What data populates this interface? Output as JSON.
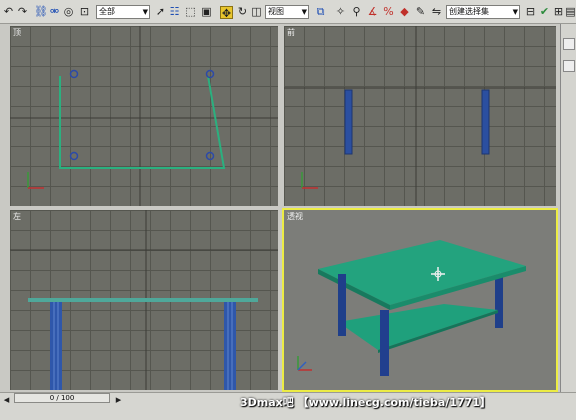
{
  "toolbar": {
    "selection_filter": "全部",
    "view_dropdown": "视图",
    "named_selection": "创建选择集"
  },
  "viewports": {
    "top": {
      "label": "顶"
    },
    "front": {
      "label": "前"
    },
    "left": {
      "label": "左"
    },
    "perspective": {
      "label": "透视"
    }
  },
  "timeline": {
    "frame": "0 / 100"
  },
  "watermark": "3Dmax吧 【www.linecg.com/tieba/1771】",
  "colors": {
    "viewport_bg": "#6c6d66",
    "active_border": "#ecec44",
    "table_top": "#23a37e",
    "legs": "#1f3f8a"
  }
}
